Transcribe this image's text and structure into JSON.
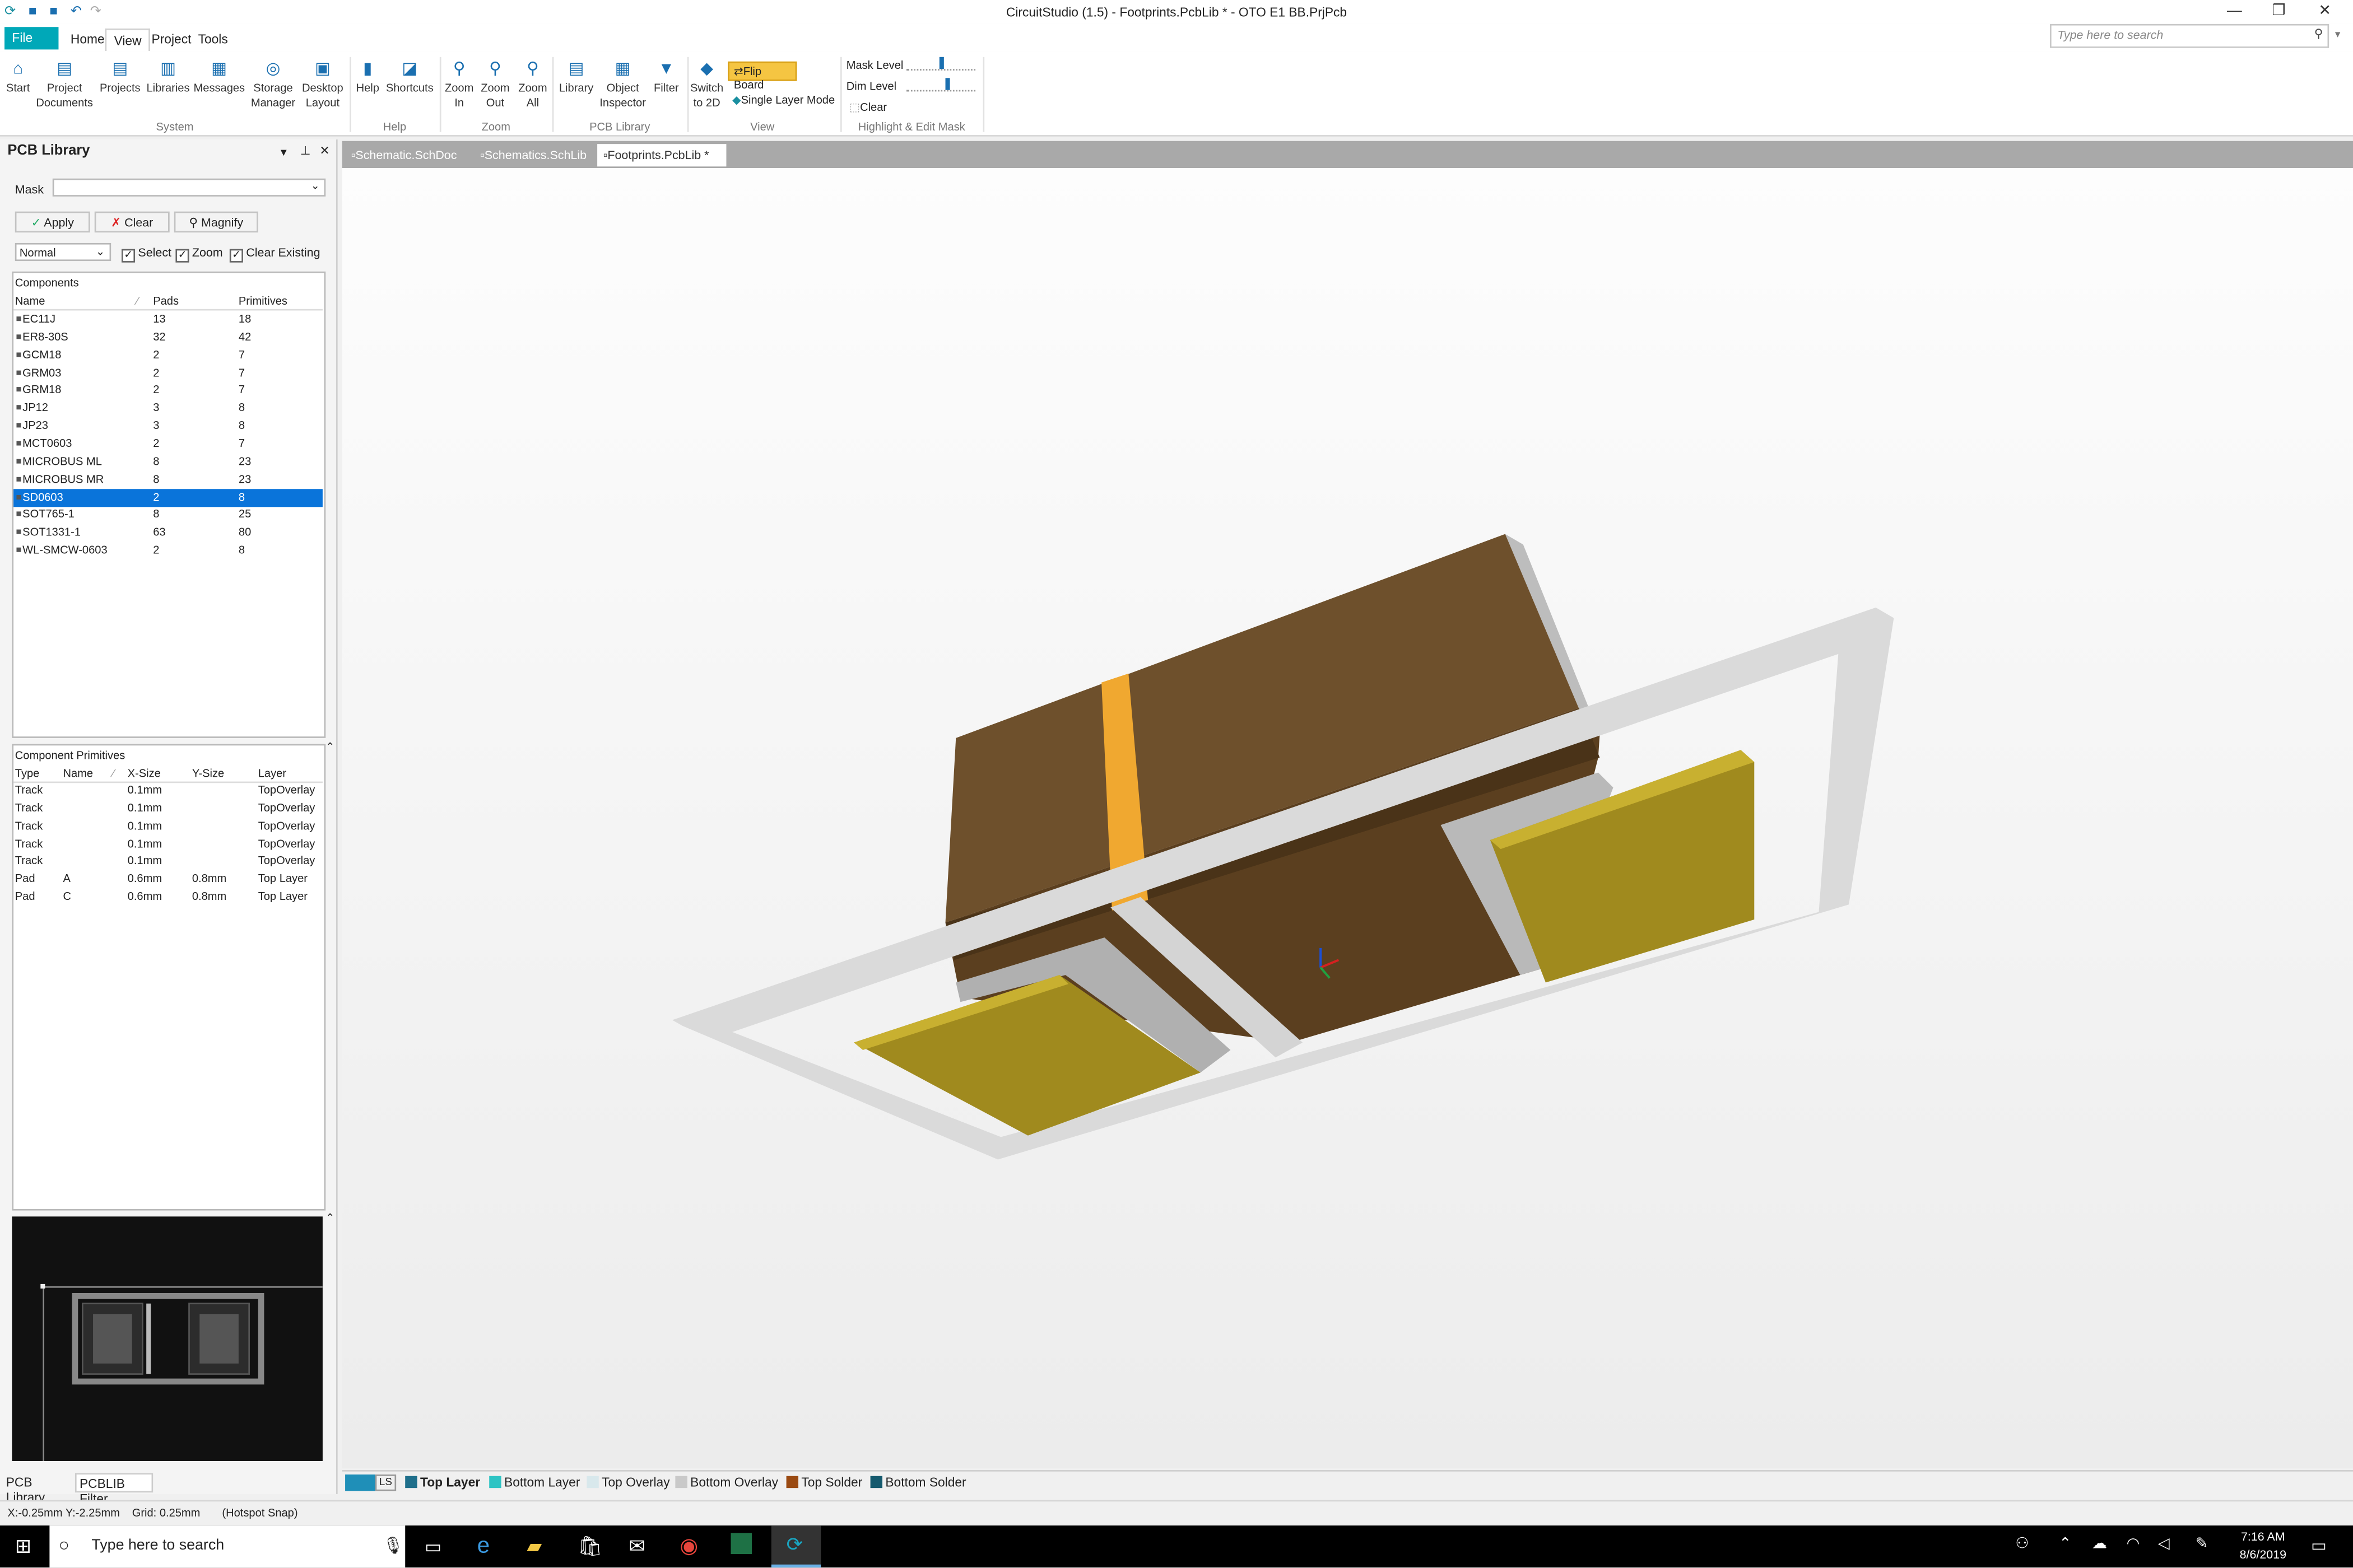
{
  "window": {
    "title": "CircuitStudio (1.5) - Footprints.PcbLib * - OTO E1 BB.PrjPcb"
  },
  "ribbon_tabs": [
    "File",
    "Home",
    "View",
    "Project",
    "Tools"
  ],
  "search": {
    "placeholder": "Type here to search"
  },
  "ribbon": {
    "buttons": [
      {
        "label": "Start",
        "icon": "home-icon"
      },
      {
        "label": "Project\nDocuments",
        "icon": "documents-icon"
      },
      {
        "label": "Projects",
        "icon": "projects-icon"
      },
      {
        "label": "Libraries",
        "icon": "libraries-icon"
      },
      {
        "label": "Messages",
        "icon": "messages-icon"
      },
      {
        "label": "Storage\nManager",
        "icon": "storage-icon"
      },
      {
        "label": "Desktop\nLayout",
        "icon": "desktop-icon"
      },
      {
        "label": "Help",
        "icon": "help-icon"
      },
      {
        "label": "Shortcuts",
        "icon": "shortcuts-icon"
      },
      {
        "label": "Zoom\nIn",
        "icon": "zoom-in-icon"
      },
      {
        "label": "Zoom\nOut",
        "icon": "zoom-out-icon"
      },
      {
        "label": "Zoom\nAll",
        "icon": "zoom-all-icon"
      },
      {
        "label": "Library",
        "icon": "library-icon"
      },
      {
        "label": "Object\nInspector",
        "icon": "inspector-icon"
      },
      {
        "label": "Filter",
        "icon": "filter-icon"
      },
      {
        "label": "Switch\nto 2D",
        "icon": "switch-2d-icon"
      }
    ],
    "groups": [
      "System",
      "Help",
      "Zoom",
      "PCB Library",
      "View",
      "Highlight & Edit Mask"
    ],
    "flip_board": "Flip Board",
    "single_layer_mode": "Single Layer Mode",
    "mask_level": "Mask Level",
    "dim_level": "Dim Level",
    "clear": "Clear"
  },
  "panel": {
    "title": "PCB Library",
    "mask_label": "Mask",
    "apply": "Apply",
    "clear": "Clear",
    "magnify": "Magnify",
    "mode": "Normal",
    "checks": [
      "Select",
      "Zoom",
      "Clear Existing"
    ],
    "components_title": "Components",
    "components_headers": [
      "Name",
      "Pads",
      "Primitives"
    ],
    "components": [
      [
        "EC11J",
        "13",
        "18"
      ],
      [
        "ER8-30S",
        "32",
        "42"
      ],
      [
        "GCM18",
        "2",
        "7"
      ],
      [
        "GRM03",
        "2",
        "7"
      ],
      [
        "GRM18",
        "2",
        "7"
      ],
      [
        "JP12",
        "3",
        "8"
      ],
      [
        "JP23",
        "3",
        "8"
      ],
      [
        "MCT0603",
        "2",
        "7"
      ],
      [
        "MICROBUS ML",
        "8",
        "23"
      ],
      [
        "MICROBUS MR",
        "8",
        "23"
      ],
      [
        "SD0603",
        "2",
        "8"
      ],
      [
        "SOT765-1",
        "8",
        "25"
      ],
      [
        "SOT1331-1",
        "63",
        "80"
      ],
      [
        "WL-SMCW-0603",
        "2",
        "8"
      ]
    ],
    "selected_component": "SD0603",
    "primitives_title": "Component Primitives",
    "primitives_headers": [
      "Type",
      "Name",
      "X-Size",
      "Y-Size",
      "Layer"
    ],
    "primitives": [
      [
        "Track",
        "",
        "0.1mm",
        "",
        "TopOverlay"
      ],
      [
        "Track",
        "",
        "0.1mm",
        "",
        "TopOverlay"
      ],
      [
        "Track",
        "",
        "0.1mm",
        "",
        "TopOverlay"
      ],
      [
        "Track",
        "",
        "0.1mm",
        "",
        "TopOverlay"
      ],
      [
        "Track",
        "",
        "0.1mm",
        "",
        "TopOverlay"
      ],
      [
        "Pad",
        "A",
        "0.6mm",
        "0.8mm",
        "Top Layer"
      ],
      [
        "Pad",
        "C",
        "0.6mm",
        "0.8mm",
        "Top Layer"
      ]
    ],
    "bottom_tabs": [
      "PCB Library",
      "PCBLIB Filter"
    ]
  },
  "doc_tabs": [
    "Schematic.SchDoc",
    "Schematics.SchLib",
    "Footprints.PcbLib *"
  ],
  "layers": {
    "ls": "LS",
    "items": [
      {
        "name": "Top Layer",
        "color": "#1f6f8b"
      },
      {
        "name": "Bottom Layer",
        "color": "#2ec4c4"
      },
      {
        "name": "Top Overlay",
        "color": "#d8e8ec"
      },
      {
        "name": "Bottom Overlay",
        "color": "#c9c9c9"
      },
      {
        "name": "Top Solder",
        "color": "#9a4a12"
      },
      {
        "name": "Bottom Solder",
        "color": "#155a6e"
      }
    ]
  },
  "status": {
    "coords": "X:-0.25mm Y:-2.25mm",
    "grid": "Grid: 0.25mm",
    "snap": "(Hotspot Snap)"
  },
  "taskbar": {
    "search_placeholder": "Type here to search",
    "time": "7:16 AM",
    "date": "8/6/2019"
  },
  "colors": {
    "accent": "#00a8b8",
    "selection": "#0a74da",
    "body": "#6e502c",
    "pad": "#a08a1e",
    "band": "#f0a830"
  }
}
